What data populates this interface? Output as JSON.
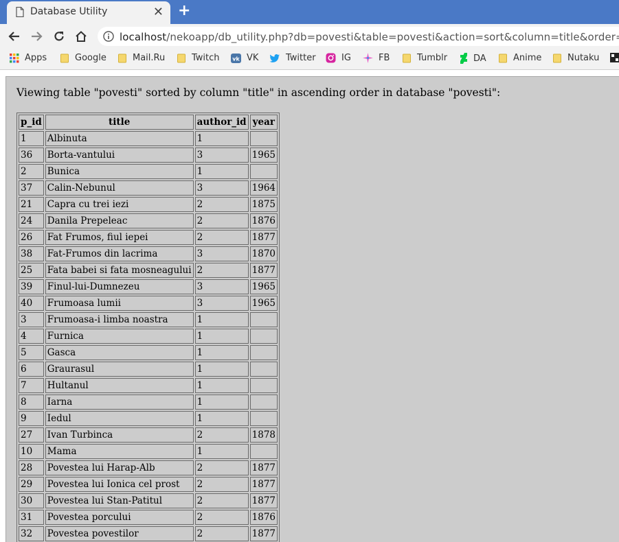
{
  "browser": {
    "tab": {
      "title": "Database Utility",
      "close": "✕"
    },
    "new_tab": "+",
    "address": {
      "host": "localhost",
      "path": "/nekoapp/db_utility.php?db=povesti&table=povesti&action=sort&column=title&order=asc"
    },
    "bookmarks": [
      {
        "label": "Apps",
        "icon": "apps-grid-icon"
      },
      {
        "label": "Google",
        "icon": "folder-icon"
      },
      {
        "label": "Mail.Ru",
        "icon": "folder-icon"
      },
      {
        "label": "Twitch",
        "icon": "folder-icon"
      },
      {
        "label": "VK",
        "icon": "vk-icon"
      },
      {
        "label": "Twitter",
        "icon": "twitter-icon"
      },
      {
        "label": "IG",
        "icon": "instagram-icon"
      },
      {
        "label": "FB",
        "icon": "sparkle-icon"
      },
      {
        "label": "Tumblr",
        "icon": "folder-icon"
      },
      {
        "label": "DA",
        "icon": "deviantart-icon"
      },
      {
        "label": "Anime",
        "icon": "folder-icon"
      },
      {
        "label": "Nutaku",
        "icon": "folder-icon"
      }
    ]
  },
  "page": {
    "heading": "Viewing table \"povesti\" sorted by column \"title\" in ascending order in database \"povesti\":",
    "columns": [
      "p_id",
      "title",
      "author_id",
      "year"
    ],
    "rows": [
      [
        "1",
        "Albinuta",
        "1",
        ""
      ],
      [
        "36",
        "Borta-vantului",
        "3",
        "1965"
      ],
      [
        "2",
        "Bunica",
        "1",
        ""
      ],
      [
        "37",
        "Calin-Nebunul",
        "3",
        "1964"
      ],
      [
        "21",
        "Capra cu trei iezi",
        "2",
        "1875"
      ],
      [
        "24",
        "Danila Prepeleac",
        "2",
        "1876"
      ],
      [
        "26",
        "Fat Frumos, fiul iepei",
        "2",
        "1877"
      ],
      [
        "38",
        "Fat-Frumos din lacrima",
        "3",
        "1870"
      ],
      [
        "25",
        "Fata babei si fata mosneagului",
        "2",
        "1877"
      ],
      [
        "39",
        "Finul-lui-Dumnezeu",
        "3",
        "1965"
      ],
      [
        "40",
        "Frumoasa lumii",
        "3",
        "1965"
      ],
      [
        "3",
        "Frumoasa-i limba noastra",
        "1",
        ""
      ],
      [
        "4",
        "Furnica",
        "1",
        ""
      ],
      [
        "5",
        "Gasca",
        "1",
        ""
      ],
      [
        "6",
        "Graurasul",
        "1",
        ""
      ],
      [
        "7",
        "Hultanul",
        "1",
        ""
      ],
      [
        "8",
        "Iarna",
        "1",
        ""
      ],
      [
        "9",
        "Iedul",
        "1",
        ""
      ],
      [
        "27",
        "Ivan Turbinca",
        "2",
        "1878"
      ],
      [
        "10",
        "Mama",
        "1",
        ""
      ],
      [
        "28",
        "Povestea lui Harap-Alb",
        "2",
        "1877"
      ],
      [
        "29",
        "Povestea lui Ionica cel prost",
        "2",
        "1877"
      ],
      [
        "30",
        "Povestea lui Stan-Patitul",
        "2",
        "1877"
      ],
      [
        "31",
        "Povestea porcului",
        "2",
        "1876"
      ],
      [
        "32",
        "Povestea povestilor",
        "2",
        "1877"
      ],
      [
        "",
        "",
        "",
        ""
      ]
    ]
  }
}
